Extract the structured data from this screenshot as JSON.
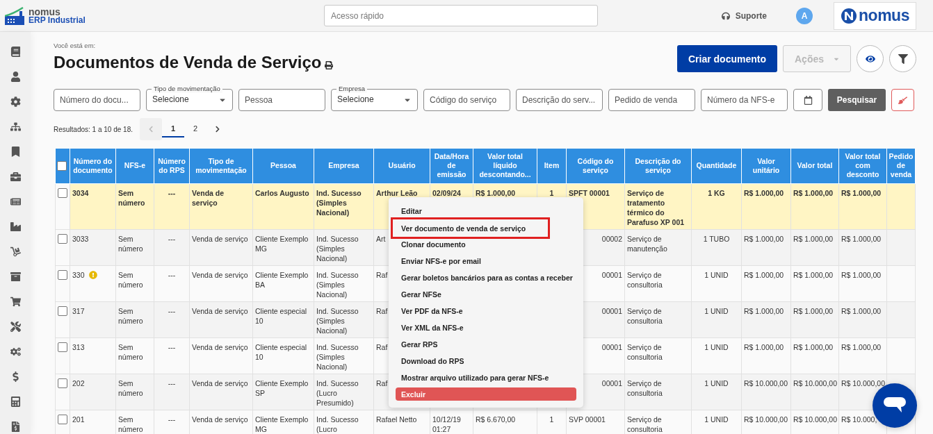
{
  "header": {
    "brand": {
      "name": "nomus",
      "product": "ERP Industrial"
    },
    "search": {
      "placeholder": "Acesso rápido"
    },
    "support": "Suporte",
    "avatar": "A",
    "logo": "nomus"
  },
  "breadcrumb": "Você está em:",
  "title": "Documentos de Venda de Serviço",
  "actions": [
    {
      "label": "Criar documento",
      "disabled": false,
      "kind": "primary"
    },
    {
      "label": "Ações",
      "disabled": true,
      "kind": "dropdown"
    }
  ],
  "filters": [
    {
      "kind": "input",
      "placeholder": "Número do docu..."
    },
    {
      "kind": "select",
      "label": "Tipo de movimentação",
      "value": "Selecione"
    },
    {
      "kind": "input",
      "placeholder": "Pessoa"
    },
    {
      "kind": "select",
      "label": "Empresa",
      "value": "Selecione"
    },
    {
      "kind": "input",
      "placeholder": "Código do serviço"
    },
    {
      "kind": "input",
      "placeholder": "Descrição do serv..."
    },
    {
      "kind": "input",
      "placeholder": "Pedido de venda"
    },
    {
      "kind": "input",
      "placeholder": "Número da NFS-e"
    }
  ],
  "search_button": "Pesquisar",
  "results": "Resultados: 1 a 10 de 18.",
  "pages": [
    {
      "label": "1",
      "selected": true
    },
    {
      "label": "2",
      "selected": false
    }
  ],
  "table": {
    "select_all": {
      "checked": false
    },
    "columns": [
      "Número do documento",
      "NFS-e",
      "Número do RPS",
      "Tipo de movimentação",
      "Pessoa",
      "Empresa",
      "Usuário",
      "Data/Hora de emissão",
      "Valor total líquido descontando...",
      "Item",
      "Código do serviço",
      "Descrição do serviço",
      "Quantidade",
      "Valor unitário",
      "Valor total",
      "Valor total com desconto",
      "Pedido de venda"
    ],
    "rows": [
      {
        "selected": true,
        "checked": false,
        "warning": false,
        "cells": [
          "3034",
          "Sem número",
          "---",
          "Venda de serviço",
          "Carlos Augusto",
          "Ind. Sucesso (Simples Nacional)",
          "Arthur Leão",
          "02/09/24",
          "R$ 1.000,00",
          "1",
          "SPFT 00001",
          "Serviço de tratamento térmico do Parafuso XP 001",
          "1 KG",
          "R$ 1.000,00",
          "R$ 1.000,00",
          "R$ 1.000,00",
          null
        ]
      },
      {
        "selected": false,
        "checked": false,
        "warning": false,
        "cells": [
          "3033",
          "Sem número",
          "---",
          "Venda de serviço",
          "Cliente Exemplo MG",
          "Ind. Sucesso (Simples Nacional)",
          "Art",
          null,
          null,
          null,
          {
            "text": "00002",
            "clipped_start": true
          },
          "Serviço de manutenção",
          "1 TUBO",
          "R$ 1.000,00",
          "R$ 1.000,00",
          "R$ 1.000,00",
          null
        ]
      },
      {
        "selected": false,
        "checked": false,
        "warning": true,
        "cells": [
          "330",
          "Sem número",
          "---",
          "Venda de serviço",
          "Cliente Exemplo BA",
          "Ind. Sucesso (Simples Nacional)",
          "Raf",
          null,
          null,
          null,
          {
            "text": "00001",
            "clipped_start": true
          },
          "Serviço de consultoria",
          "1 UNID",
          "R$ 1.000,00",
          "R$ 1.000,00",
          "R$ 1.000,00",
          null
        ]
      },
      {
        "selected": false,
        "checked": false,
        "warning": false,
        "cells": [
          "317",
          "Sem número",
          "---",
          "Venda de serviço",
          "Cliente especial 10",
          "Ind. Sucesso (Simples Nacional)",
          "Raf",
          null,
          null,
          null,
          {
            "text": "00001",
            "clipped_start": true
          },
          "Serviço de consultoria",
          "1 UNID",
          "R$ 1.000,00",
          "R$ 1.000,00",
          "R$ 1.000,00",
          null
        ]
      },
      {
        "selected": false,
        "checked": false,
        "warning": false,
        "cells": [
          "313",
          "Sem número",
          "---",
          "Venda de serviço",
          "Cliente especial 10",
          "Ind. Sucesso (Simples Nacional)",
          "Raf",
          null,
          null,
          null,
          {
            "text": "00001",
            "clipped_start": true
          },
          "Serviço de consultoria",
          "1 UNID",
          "R$ 1.000,00",
          "R$ 1.000,00",
          "R$ 1.000,00",
          null
        ]
      },
      {
        "selected": false,
        "checked": false,
        "warning": false,
        "cells": [
          "202",
          "Sem número",
          "---",
          "Venda de serviço",
          "Cliente Exemplo SP",
          "Ind. Sucesso (Lucro Presumido)",
          "Raf",
          null,
          null,
          null,
          {
            "text": "00001",
            "clipped_start": true
          },
          "Serviço de consultoria",
          "1 UNID",
          "R$ 10.000,00",
          "R$ 10.000,00",
          "R$ 10.000,00",
          null
        ]
      },
      {
        "selected": false,
        "checked": false,
        "warning": false,
        "cells": [
          "201",
          "Sem número",
          "---",
          "Venda de serviço",
          "Cliente Exemplo MG",
          "Ind. Sucesso (Lucro",
          "Rafael Netto",
          "10/12/19 01:27",
          "R$ 6.670,00",
          "1",
          "SVP 00001",
          "Serviço de consultoria",
          "1 UNID",
          "R$ 10.000,00",
          "R$ 10.000,00",
          "R$ 10.000,",
          null
        ]
      }
    ]
  },
  "context_menu": [
    {
      "label": "Editar",
      "kind": "item",
      "highlighted": false
    },
    {
      "label": "Ver documento de venda de serviço",
      "kind": "item",
      "highlighted": true
    },
    {
      "label": "Clonar documento",
      "kind": "item",
      "highlighted": false
    },
    {
      "label": "Enviar NFS-e por email",
      "kind": "item",
      "highlighted": false
    },
    {
      "label": "Gerar boletos bancários para as contas a receber",
      "kind": "item",
      "highlighted": false
    },
    {
      "label": "Gerar NFSe",
      "kind": "item",
      "highlighted": false
    },
    {
      "label": "Ver PDF da NFS-e",
      "kind": "item",
      "highlighted": false
    },
    {
      "label": "Ver XML da NFS-e",
      "kind": "item",
      "highlighted": false
    },
    {
      "label": "Gerar RPS",
      "kind": "item",
      "highlighted": false
    },
    {
      "label": "Download do RPS",
      "kind": "item",
      "highlighted": false
    },
    {
      "label": "Mostrar arquivo utilizado para gerar NFS-e",
      "kind": "item",
      "highlighted": false
    },
    {
      "label": "Excluir",
      "kind": "danger",
      "highlighted": false
    }
  ]
}
